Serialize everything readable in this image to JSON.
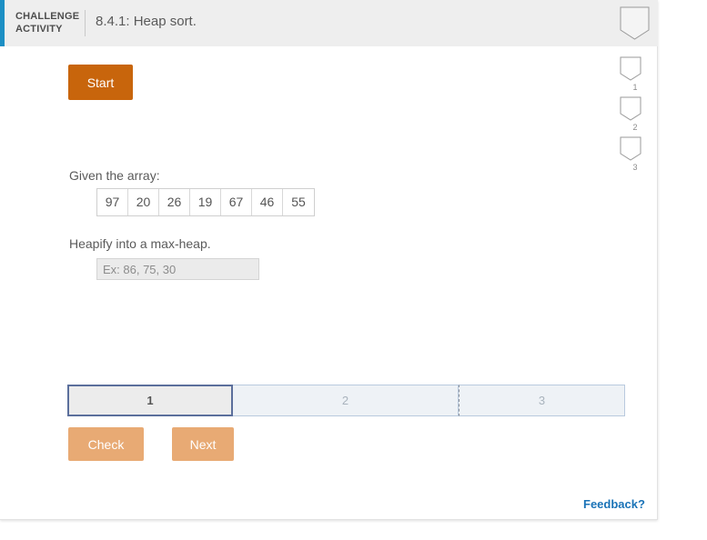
{
  "header": {
    "accent_color": "#1c8fc4",
    "label_line1": "CHALLENGE",
    "label_line2": "ACTIVITY",
    "title": "8.4.1: Heap sort.",
    "bookmark_icon": "bookmark-shield-icon"
  },
  "markers": [
    {
      "number": "1"
    },
    {
      "number": "2"
    },
    {
      "number": "3"
    }
  ],
  "main": {
    "start_label": "Start",
    "given_label": "Given the array:",
    "array": [
      "97",
      "20",
      "26",
      "19",
      "67",
      "46",
      "55"
    ],
    "prompt": "Heapify into a max-heap.",
    "input_value": "",
    "input_placeholder": "Ex: 86, 75, 30"
  },
  "progress": {
    "segments": [
      {
        "label": "1",
        "state": "active"
      },
      {
        "label": "2",
        "state": "idle"
      },
      {
        "label": "3",
        "state": "idle"
      }
    ]
  },
  "actions": {
    "check_label": "Check",
    "next_label": "Next"
  },
  "footer": {
    "feedback_label": "Feedback?"
  },
  "colors": {
    "start_button": "#c8650c",
    "disabled_button": "#e8aa74",
    "active_segment_border": "#5b6f9c",
    "link": "#1a73b7"
  }
}
